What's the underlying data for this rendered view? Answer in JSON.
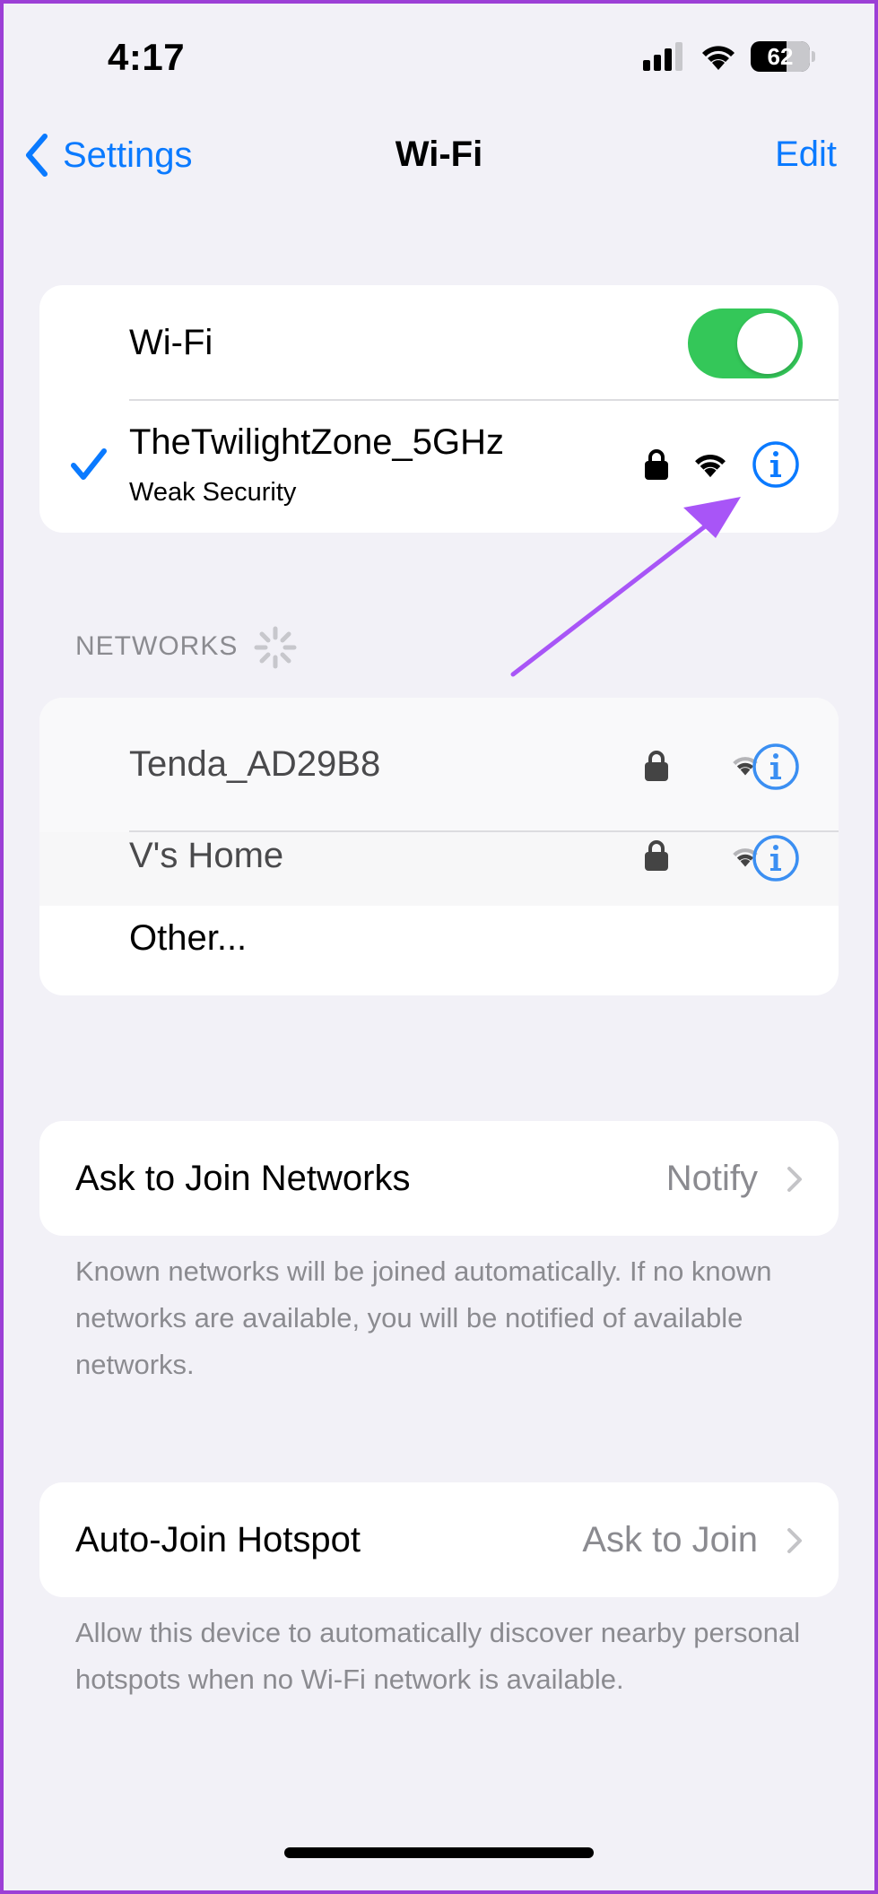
{
  "status_bar": {
    "time": "4:17",
    "battery": "62"
  },
  "nav": {
    "back_label": "Settings",
    "title": "Wi-Fi",
    "edit_label": "Edit"
  },
  "wifi_toggle": {
    "label": "Wi-Fi",
    "on": true
  },
  "connected_network": {
    "name": "TheTwilightZone_5GHz",
    "subtitle": "Weak Security",
    "icons": [
      "checkmark-icon",
      "lock-icon",
      "wifi-signal-icon",
      "info-icon"
    ]
  },
  "networks": {
    "header": "NETWORKS",
    "items": [
      {
        "name": "Tenda_AD29B8"
      },
      {
        "name": "V's Home"
      }
    ],
    "other_label": "Other..."
  },
  "ask_to_join": {
    "label": "Ask to Join Networks",
    "value": "Notify",
    "footnote": "Known networks will be joined automatically. If no known networks are available, you will be notified of available networks."
  },
  "auto_join_hotspot": {
    "label": "Auto-Join Hotspot",
    "value": "Ask to Join",
    "footnote": "Allow this device to automatically discover nearby personal hotspots when no Wi-Fi network is available."
  },
  "colors": {
    "accent": "#0a7aff",
    "toggle_on": "#34c759",
    "annotation_arrow": "#a855f7",
    "frame": "#9c3fd6"
  }
}
